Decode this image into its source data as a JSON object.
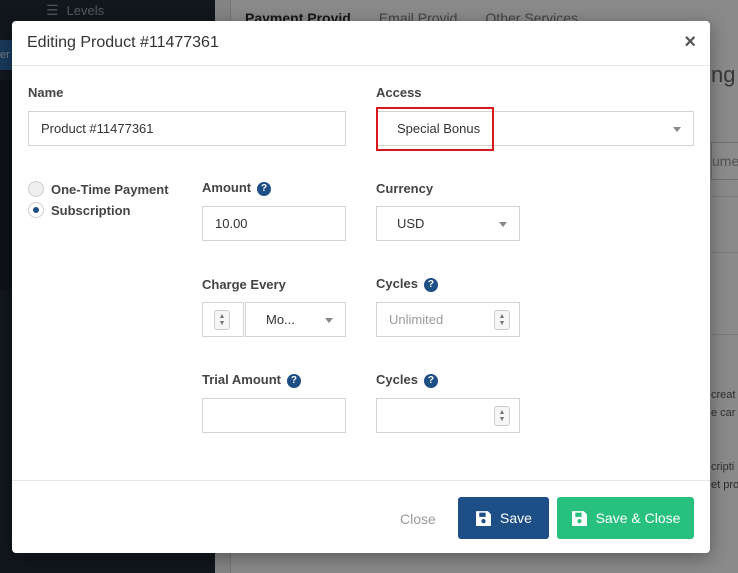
{
  "background": {
    "sidebar_item": "Levels",
    "sidebar_stub": "er",
    "tabs": [
      "Payment Provid",
      "Email Provid",
      "Other Services"
    ],
    "right_title": "ng",
    "right_input": "ume",
    "right_texts": [
      "creat",
      "e car",
      "cripti",
      "et pro"
    ]
  },
  "modal": {
    "title": "Editing Product #11477361",
    "close_icon": "×",
    "name_label": "Name",
    "name_value": "Product #11477361",
    "access_label": "Access",
    "access_value": "Special Bonus",
    "payment_options": [
      {
        "label": "One-Time Payment",
        "checked": false
      },
      {
        "label": "Subscription",
        "checked": true
      }
    ],
    "amount_label": "Amount",
    "amount_value": "10.00",
    "currency_label": "Currency",
    "currency_value": "USD",
    "charge_every_label": "Charge Every",
    "charge_every_unit": "Mo...",
    "cycles_label": "Cycles",
    "cycles_placeholder": "Unlimited",
    "trial_amount_label": "Trial Amount",
    "trial_cycles_label": "Cycles",
    "help_icon": "?",
    "footer": {
      "close_label": "Close",
      "save_label": "Save",
      "save_close_label": "Save & Close"
    }
  },
  "colors": {
    "primary": "#1d4f86",
    "success": "#28c07e",
    "highlight": "#d9181b"
  }
}
